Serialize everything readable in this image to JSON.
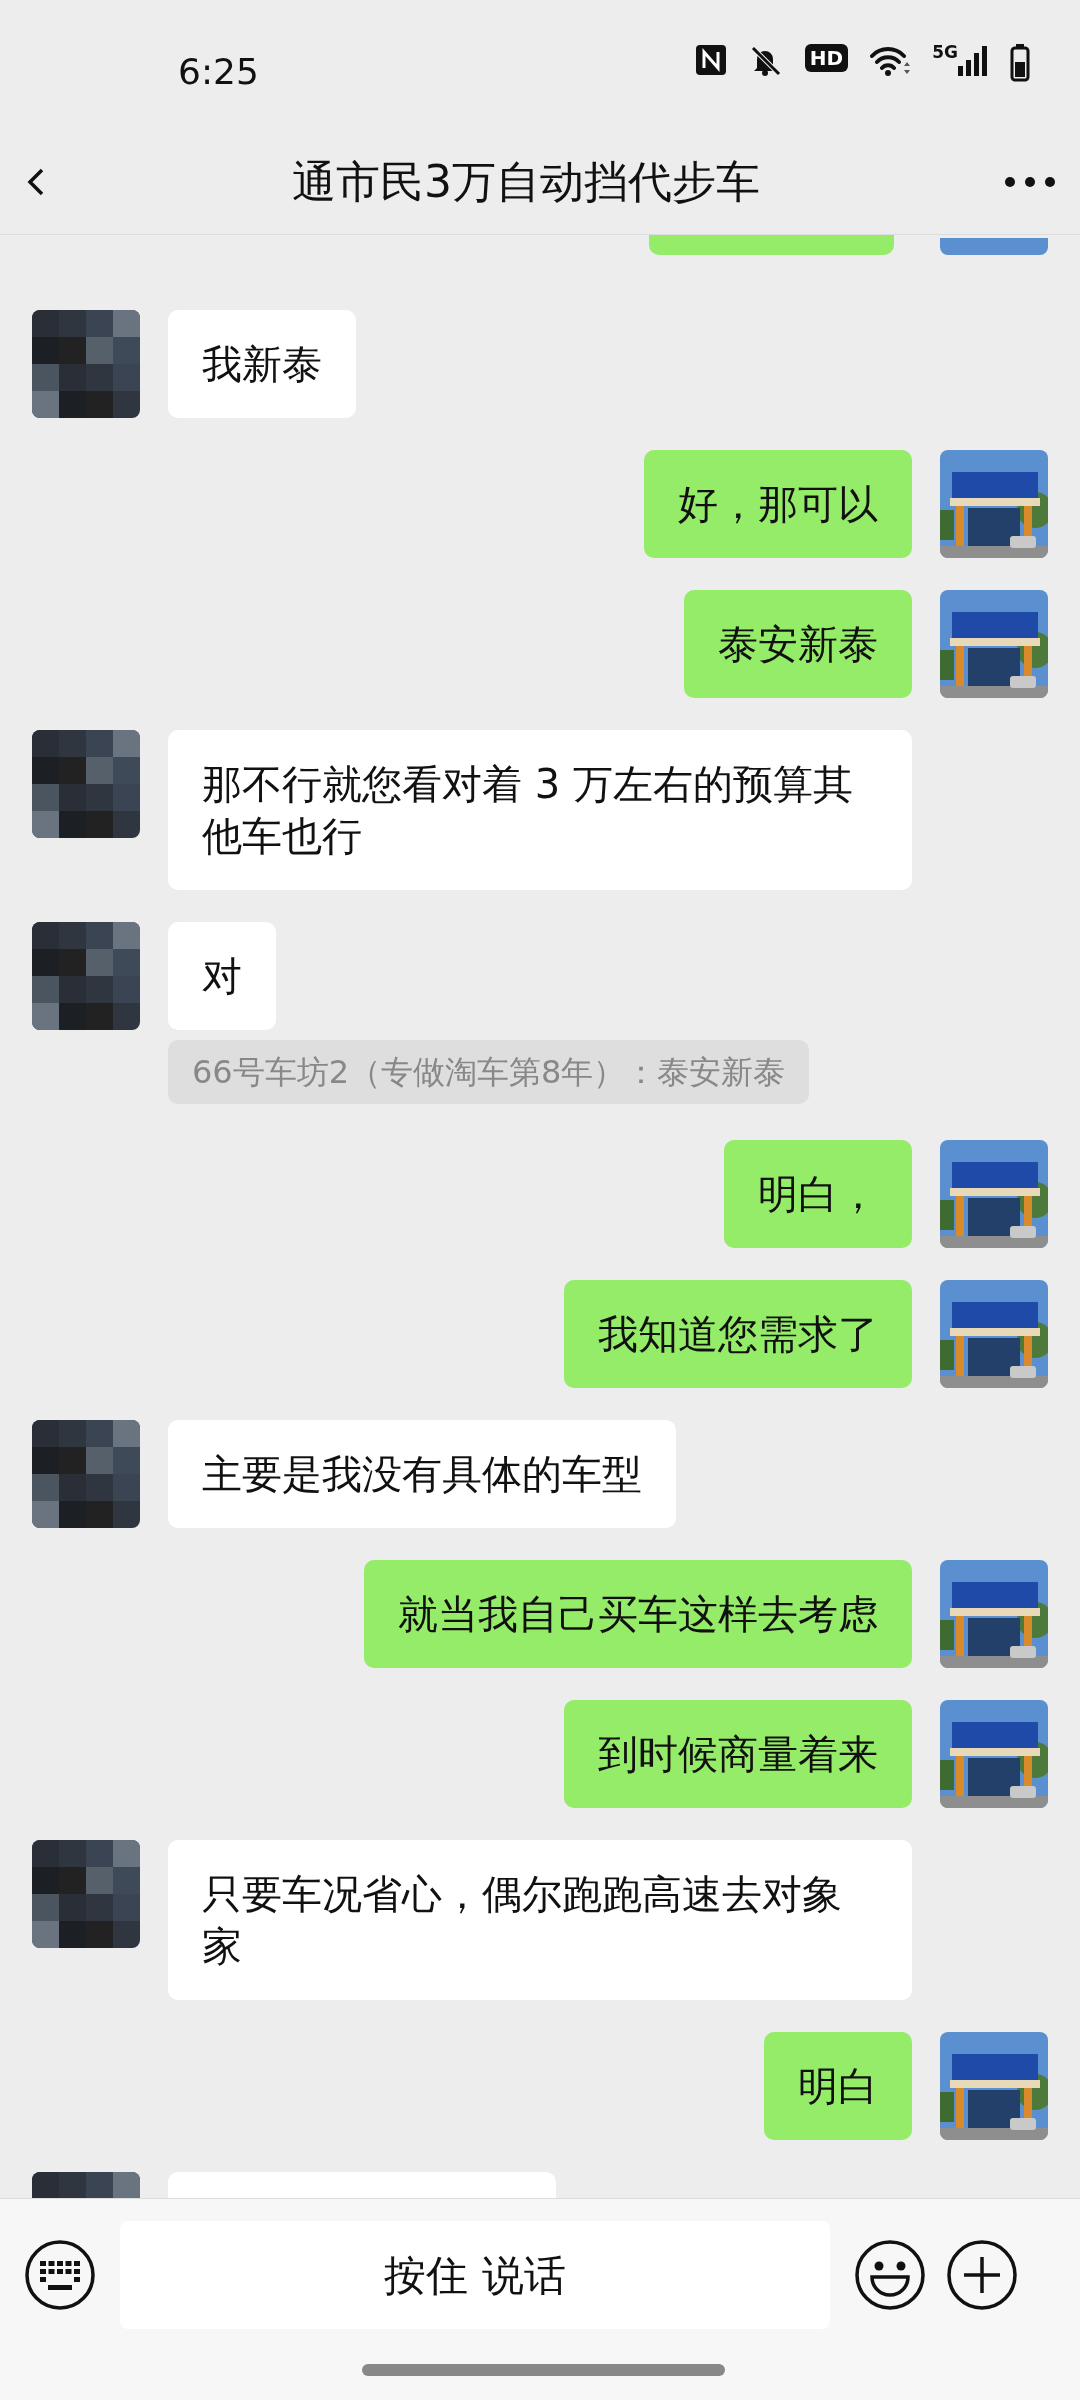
{
  "status_bar": {
    "time": "6:25",
    "hd_label": "HD",
    "network": "5G"
  },
  "nav": {
    "title": "通市民3万自动挡代步车"
  },
  "messages": [
    {
      "kind": "sentcut"
    },
    {
      "kind": "received",
      "text": "我新泰"
    },
    {
      "kind": "sent",
      "text": "好，那可以"
    },
    {
      "kind": "sent",
      "text": "泰安新泰"
    },
    {
      "kind": "received",
      "text": "那不行就您看对着 3 万左右的预算其他车也行"
    },
    {
      "kind": "received",
      "text": "对"
    },
    {
      "kind": "system",
      "text": "66号车坊2（专做淘车第8年）：泰安新泰"
    },
    {
      "kind": "sent",
      "text": "明白，"
    },
    {
      "kind": "sent",
      "text": "我知道您需求了"
    },
    {
      "kind": "received",
      "text": "主要是我没有具体的车型"
    },
    {
      "kind": "sent",
      "text": "就当我自己买车这样去考虑"
    },
    {
      "kind": "sent",
      "text": "到时候商量着来"
    },
    {
      "kind": "received",
      "text": "只要车况省心，偶尔跑跑高速去对象家"
    },
    {
      "kind": "sent",
      "text": "明白"
    },
    {
      "kind": "receivedcut"
    }
  ],
  "input_bar": {
    "hold_to_talk": "按住 说话"
  }
}
